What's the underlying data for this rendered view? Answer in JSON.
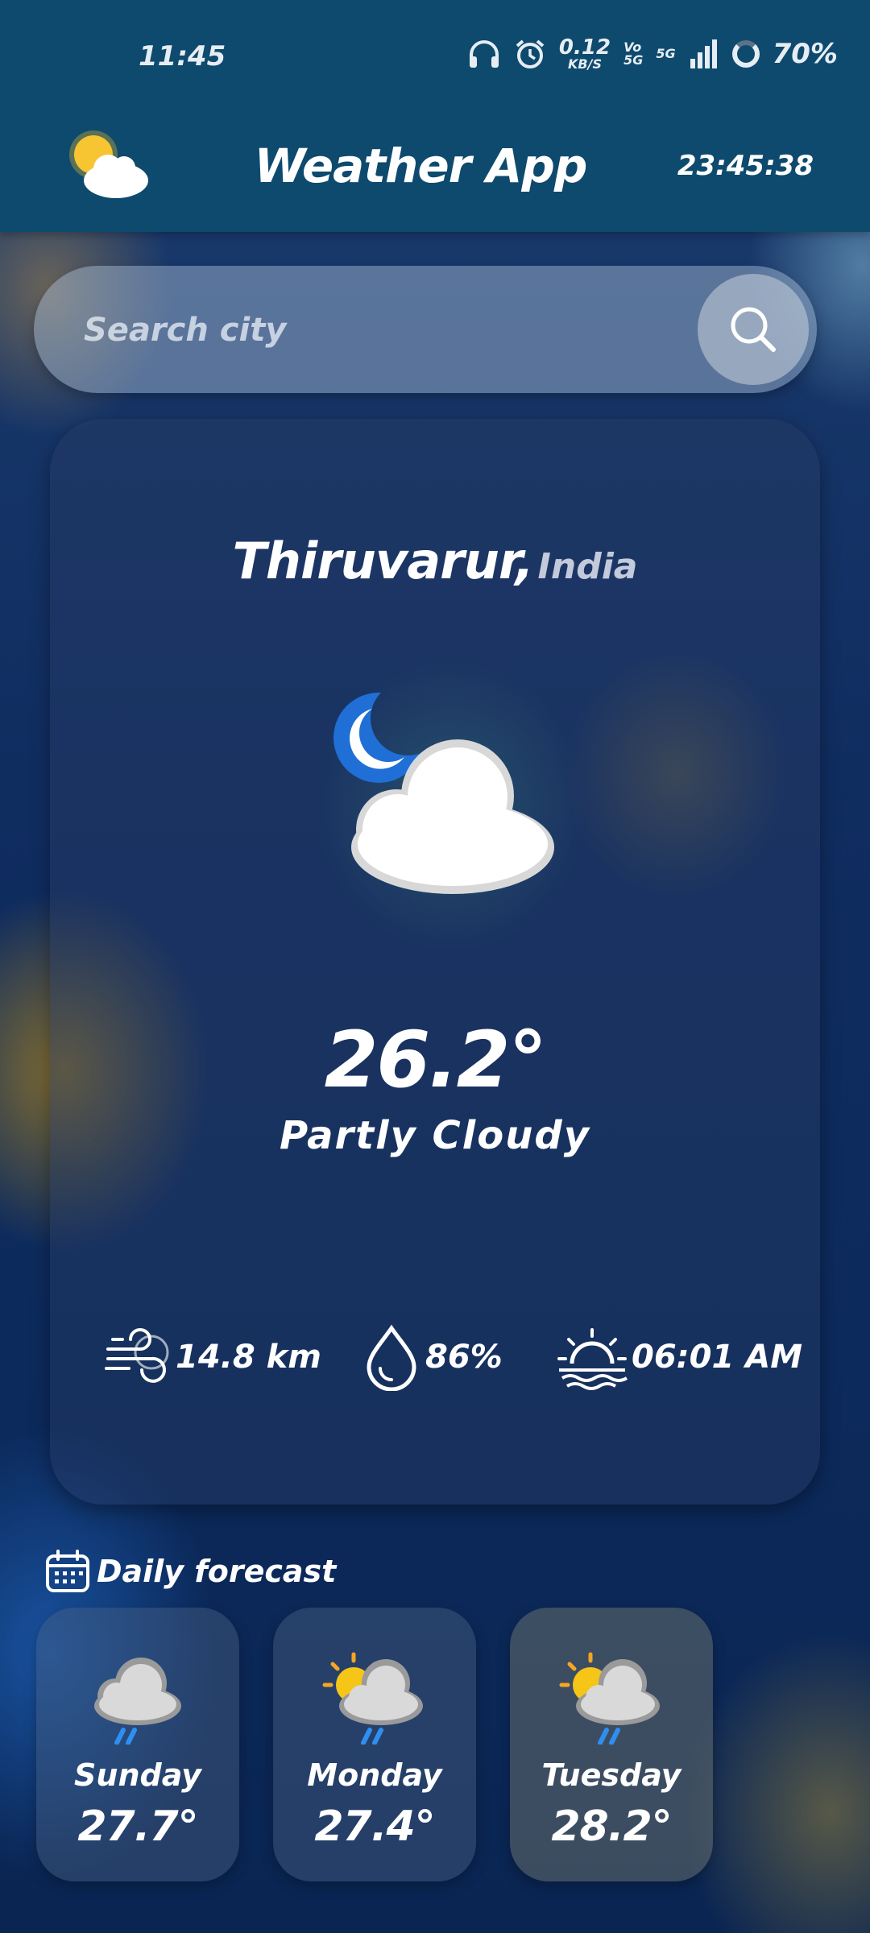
{
  "status_bar": {
    "time": "11:45",
    "net_speed_value": "0.12",
    "net_speed_unit": "KB/S",
    "vo_top": "Vo",
    "vo_bottom": "5G",
    "network": "5G",
    "battery": "70%",
    "icons": [
      "headphones-icon",
      "alarm-icon",
      "signal-icon",
      "battery-ring-icon"
    ]
  },
  "header": {
    "title": "Weather App",
    "clock": "23:45:38",
    "logo_icon": "sun-cloud-icon"
  },
  "search": {
    "placeholder": "Search city",
    "value": "",
    "button_icon": "search-icon"
  },
  "current": {
    "city": "Thiruvarur",
    "separator": ",",
    "country": "India",
    "condition_icon": "moon-cloud-icon",
    "temperature": "26.2°",
    "description": "Partly Cloudy",
    "wind": "14.8 km",
    "humidity": "86%",
    "sunrise": "06:01 AM"
  },
  "forecast": {
    "heading": "Daily forecast",
    "days": [
      {
        "day": "Sunday",
        "temp": "27.7°",
        "icon": "cloud-rain-icon"
      },
      {
        "day": "Monday",
        "temp": "27.4°",
        "icon": "sun-cloud-rain-icon"
      },
      {
        "day": "Tuesday",
        "temp": "28.2°",
        "icon": "sun-cloud-rain-icon"
      }
    ]
  },
  "colors": {
    "header_bg": "#0e4a6e",
    "rain_blue": "#2f8ff0",
    "sun_yellow": "#f5c518",
    "moon_blue": "#1f6fd6"
  }
}
